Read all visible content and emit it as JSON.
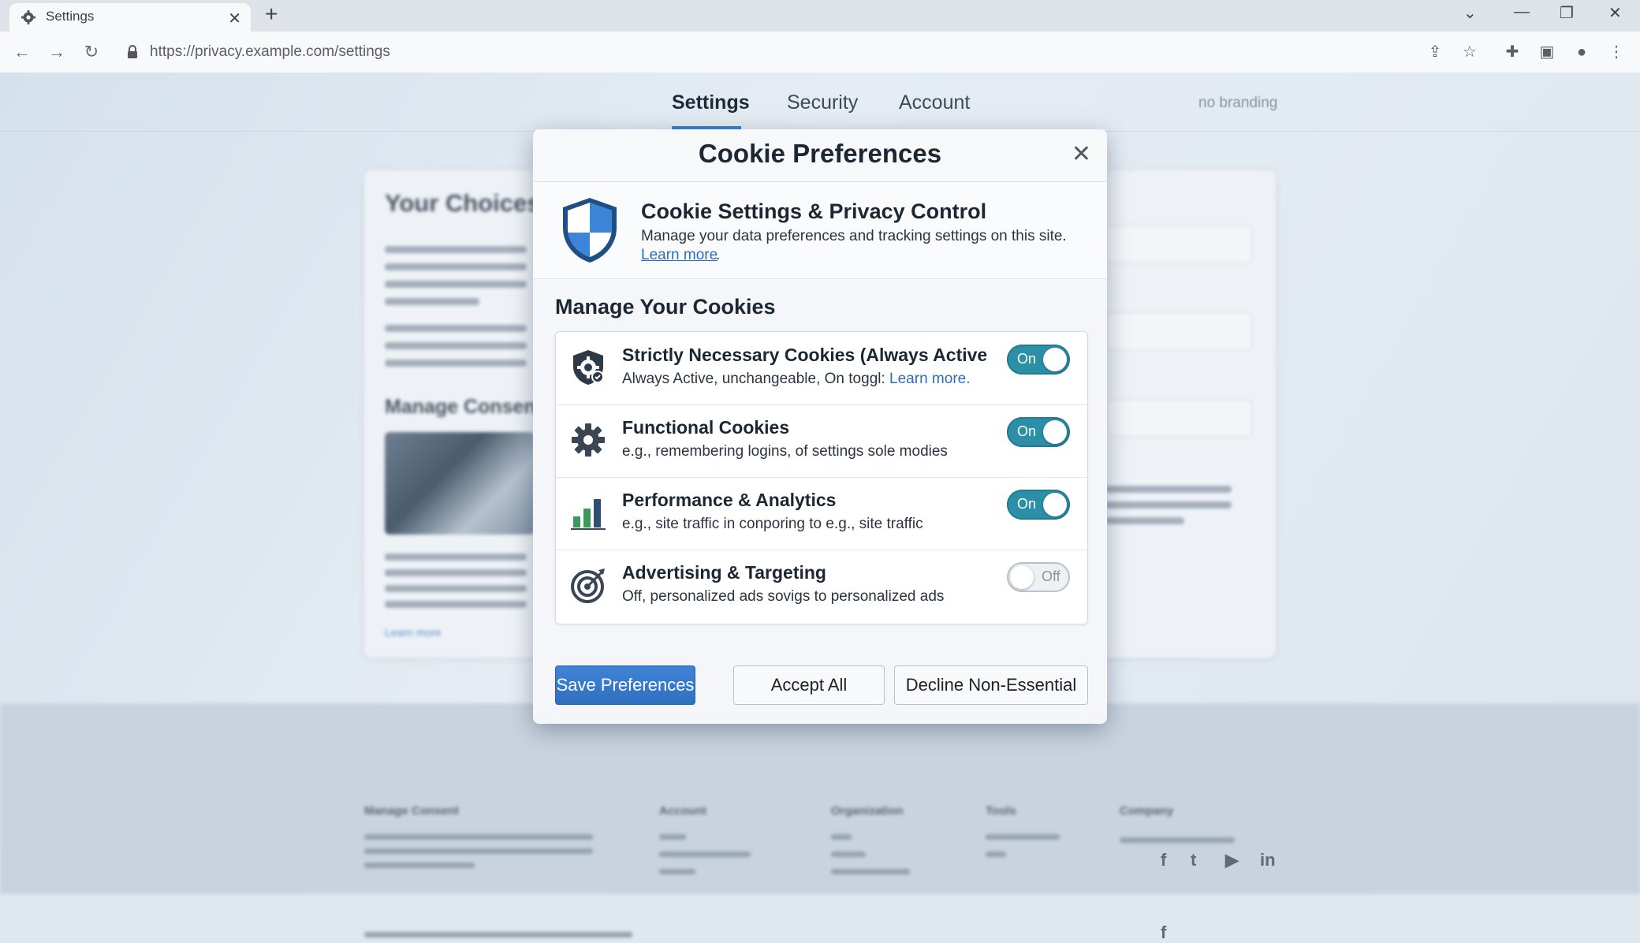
{
  "browser": {
    "tab_title": "Settings",
    "url": "https://privacy.example.com/settings"
  },
  "page": {
    "nav_tabs": [
      "Settings",
      "Security",
      "Account"
    ],
    "active_tab": "Settings",
    "branding_note": "no branding",
    "bg_heading": "Your Choices M",
    "bg_subheading": "Manage Consent",
    "bg_link": "Learn more",
    "footer_headings": [
      "Manage Consent",
      "Account",
      "Organization",
      "Tools",
      "Company"
    ]
  },
  "modal": {
    "title": "Cookie Preferences",
    "intro_title": "Cookie Settings & Privacy Control",
    "intro_text": "Manage your data preferences and tracking settings on this site.",
    "intro_link": "Learn more",
    "section_title": "Manage Your Cookies",
    "cookies": [
      {
        "title": "Strictly Necessary Cookies (Always Active",
        "desc": "Always Active, unchangeable, On toggl: ",
        "desc_link": "Learn more.",
        "state": "On",
        "icon": "gear-shield-icon"
      },
      {
        "title": "Functional Cookies",
        "desc": "e.g., remembering logins, of settings sole modies",
        "state": "On",
        "icon": "gear-icon"
      },
      {
        "title": "Performance & Analytics",
        "desc": "e.g., site traffic in conporing to e.g., site traffic",
        "state": "On",
        "icon": "bar-chart-icon"
      },
      {
        "title": "Advertising & Targeting",
        "desc": "Off, personalized ads sovigs to personalized ads",
        "state": "Off",
        "icon": "target-icon"
      }
    ],
    "buttons": {
      "save": "Save Preferences",
      "accept": "Accept All",
      "decline": "Decline Non-Essential"
    }
  },
  "colors": {
    "accent": "#2f6fbf",
    "toggle_on": "#2c8fa8",
    "link": "#2d6db6"
  }
}
